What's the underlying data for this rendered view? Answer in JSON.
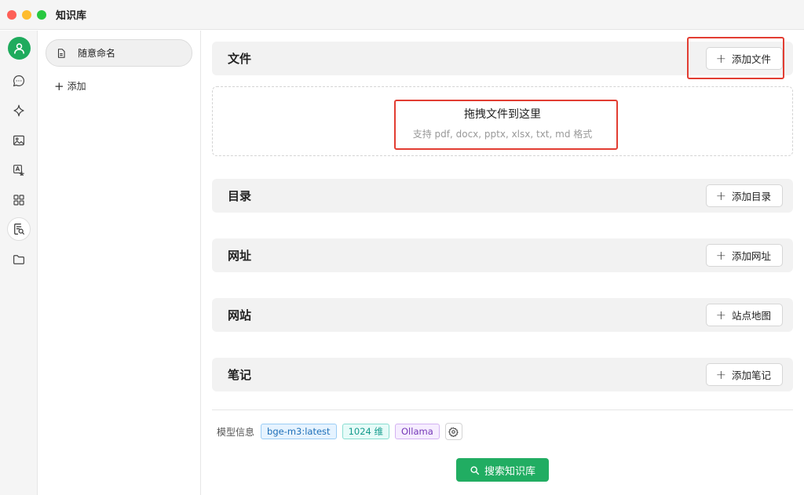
{
  "window": {
    "title": "知识库"
  },
  "rail": {
    "items": [
      {
        "name": "chat-icon"
      },
      {
        "name": "sparkle-icon"
      },
      {
        "name": "image-icon"
      },
      {
        "name": "translate-icon"
      },
      {
        "name": "apps-icon"
      },
      {
        "name": "knowledge-base-icon",
        "active": true
      },
      {
        "name": "folder-icon"
      }
    ]
  },
  "knowledge_list": {
    "items": [
      {
        "label": "随意命名",
        "icon": "document-icon"
      }
    ],
    "add_label": "添加"
  },
  "sections": [
    {
      "title": "文件",
      "button": "添加文件"
    },
    {
      "title": "目录",
      "button": "添加目录"
    },
    {
      "title": "网址",
      "button": "添加网址"
    },
    {
      "title": "网站",
      "button": "站点地图"
    },
    {
      "title": "笔记",
      "button": "添加笔记"
    }
  ],
  "dropzone": {
    "title": "拖拽文件到这里",
    "subtitle": "支持 pdf, docx, pptx, xlsx, txt, md 格式"
  },
  "model_info": {
    "label": "模型信息",
    "tags": [
      "bge-m3:latest",
      "1024 维",
      "Ollama"
    ]
  },
  "search_button": "搜索知识库",
  "colors": {
    "accent_green": "#21ad62",
    "highlight_red": "#e23d32"
  }
}
